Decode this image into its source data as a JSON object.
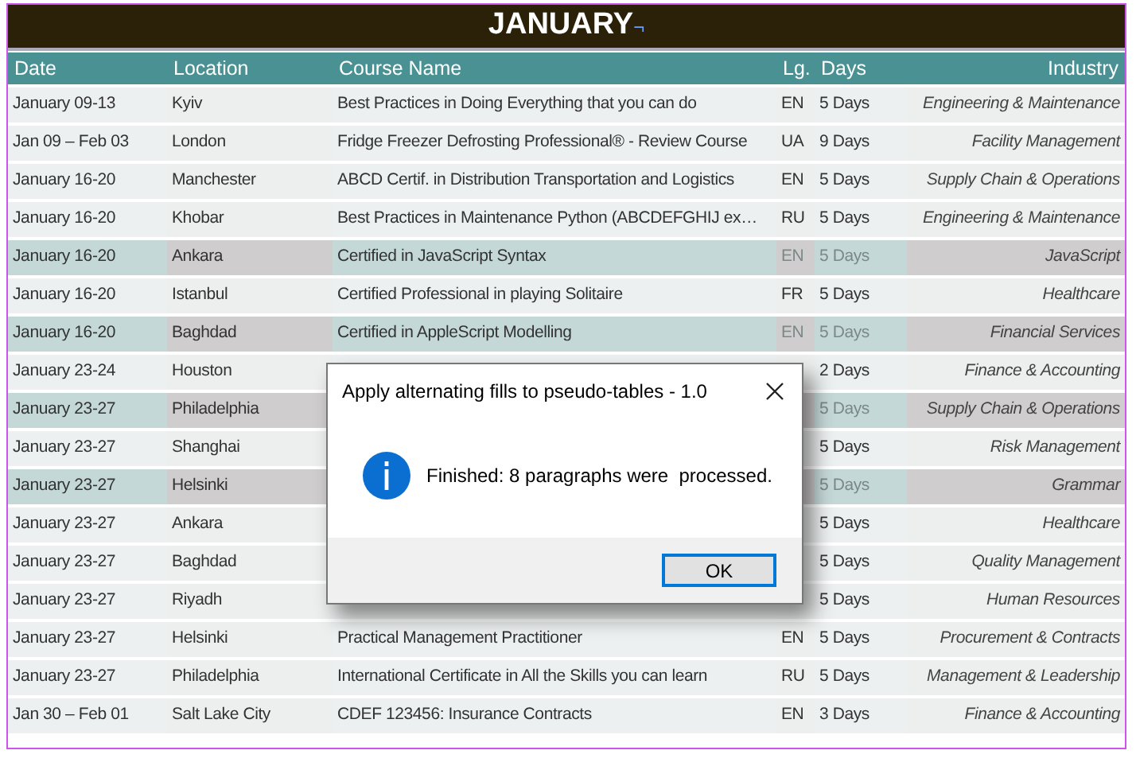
{
  "title": "JANUARY",
  "title_mark": "¬",
  "columns": [
    "Date",
    "Location",
    "Course Name",
    "Lg.",
    "Days",
    "Industry"
  ],
  "rows": [
    {
      "date": "January 09-13",
      "location": "Kyiv",
      "course": "Best Practices in Doing Everything that you can do",
      "lg": "EN",
      "days": "5 Days",
      "industry": "Engineering & Maintenance",
      "shaded": false
    },
    {
      "date": "Jan 09 – Feb 03",
      "location": "London",
      "course": "Fridge Freezer Defrosting Professional® - Review Course",
      "lg": "UA",
      "days": "9 Days",
      "industry": "Facility Management",
      "shaded": false
    },
    {
      "date": "January 16-20",
      "location": "Manchester",
      "course": "ABCD Certif. in Distribution Transportation and Logistics",
      "lg": "EN",
      "days": "5 Days",
      "industry": "Supply Chain & Operations",
      "shaded": false
    },
    {
      "date": "January 16-20",
      "location": "Khobar",
      "course": "Best Practices in Maintenance Python (ABCDEFGHIJ ex…",
      "lg": "RU",
      "days": "5 Days",
      "industry": "Engineering & Maintenance",
      "shaded": false
    },
    {
      "date": "January 16-20",
      "location": "Ankara",
      "course": "Certified in JavaScript Syntax",
      "lg": "EN",
      "days": "5 Days",
      "industry": "JavaScript",
      "shaded": true
    },
    {
      "date": "January 16-20",
      "location": "Istanbul",
      "course": "Certified Professional in playing Solitaire",
      "lg": "FR",
      "days": "5 Days",
      "industry": "Healthcare",
      "shaded": false
    },
    {
      "date": "January 16-20",
      "location": "Baghdad",
      "course": "Certified in AppleScript Modelling",
      "lg": "EN",
      "days": "5 Days",
      "industry": "Financial Services",
      "shaded": true
    },
    {
      "date": "January 23-24",
      "location": "Houston",
      "days": "2 Days",
      "industry": "Finance & Accounting",
      "shaded": false
    },
    {
      "date": "January 23-27",
      "location": "Philadelphia",
      "days": "5 Days",
      "industry": "Supply Chain & Operations",
      "shaded": true
    },
    {
      "date": "January 23-27",
      "location": "Shanghai",
      "days": "5 Days",
      "industry": "Risk Management",
      "shaded": false
    },
    {
      "date": "January 23-27",
      "location": "Helsinki",
      "days": "5 Days",
      "industry": "Grammar",
      "shaded": true
    },
    {
      "date": "January 23-27",
      "location": "Ankara",
      "days": "5 Days",
      "industry": "Healthcare",
      "shaded": false
    },
    {
      "date": "January 23-27",
      "location": "Baghdad",
      "days": "5 Days",
      "industry": "Quality Management",
      "shaded": false
    },
    {
      "date": "January 23-27",
      "location": "Riyadh",
      "days": "5 Days",
      "industry": "Human Resources",
      "shaded": false
    },
    {
      "date": "January 23-27",
      "location": "Helsinki",
      "course": "Practical Management Practitioner",
      "lg": "EN",
      "days": "5 Days",
      "industry": "Procurement & Contracts",
      "shaded": false
    },
    {
      "date": "January 23-27",
      "location": "Philadelphia",
      "course": "International Certificate in All the Skills you can learn",
      "lg": "RU",
      "days": "5 Days",
      "industry": "Management & Leadership",
      "shaded": false
    },
    {
      "date": "Jan 30 – Feb 01",
      "location": "Salt Lake City",
      "course": "CDEF 123456: Insurance Contracts",
      "lg": "EN",
      "days": "3 Days",
      "industry": "Finance & Accounting",
      "shaded": false
    }
  ],
  "dialog": {
    "title": "Apply alternating fills to pseudo-tables - 1.0",
    "message": "Finished: 8 paragraphs were  processed.",
    "button": "OK"
  }
}
